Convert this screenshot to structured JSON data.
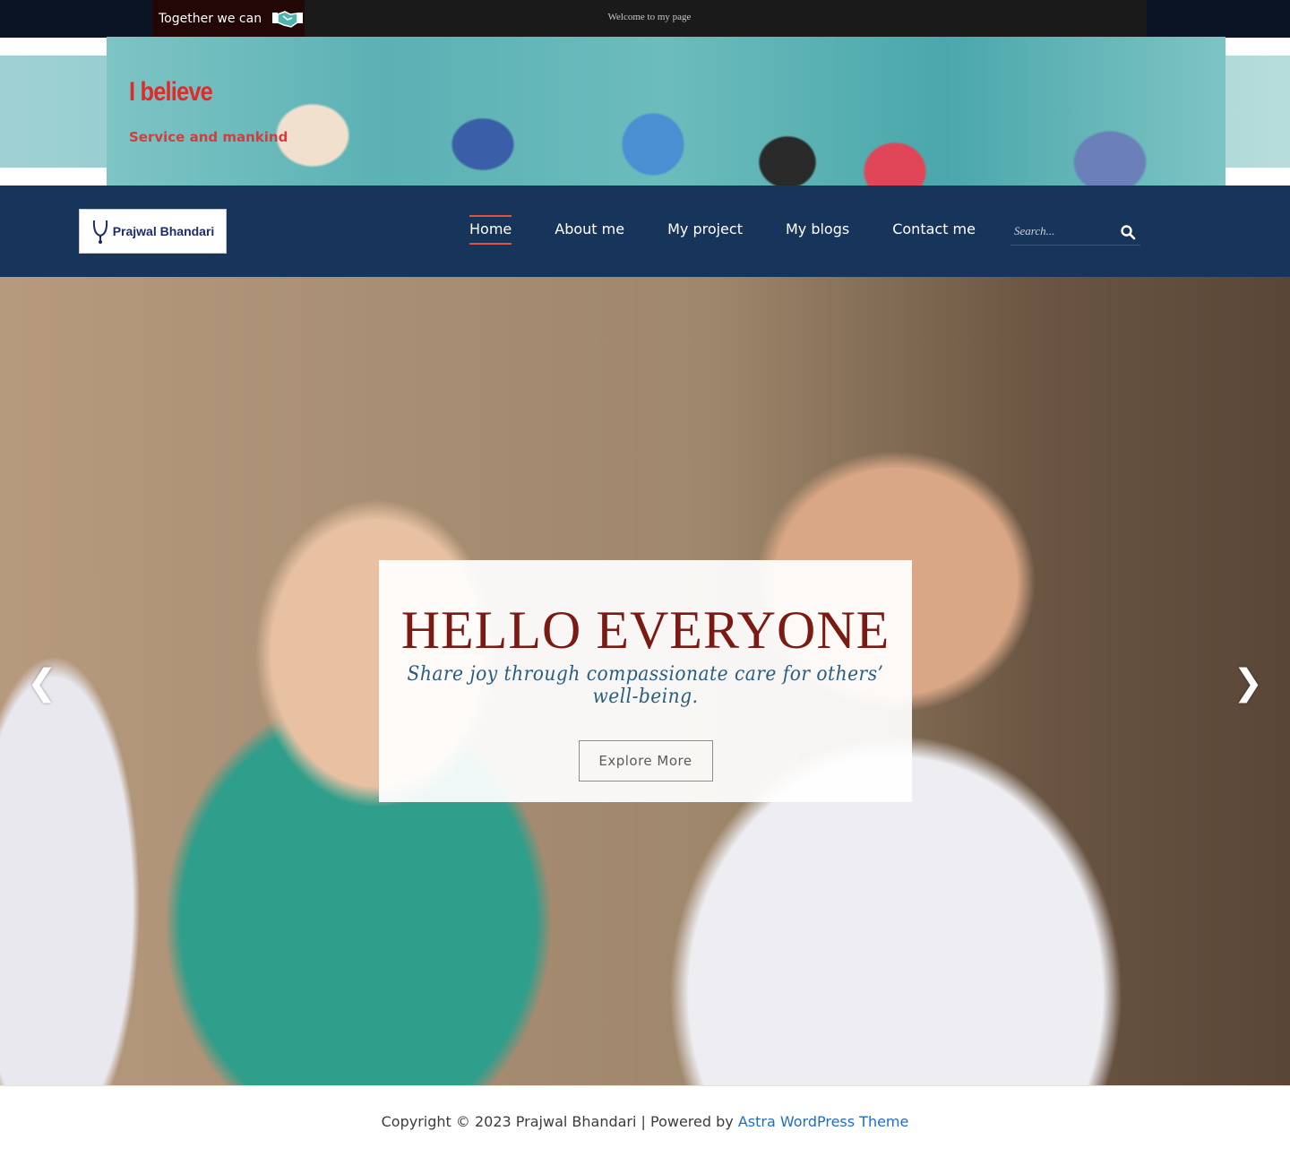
{
  "topbar": {
    "tagline": "Together we can",
    "tagline_icon": "handshake-icon",
    "welcome": "Welcome to my page"
  },
  "header": {
    "site_title": "I believe",
    "site_tagline": "Service and mankind"
  },
  "nav": {
    "logo_text": "Prajwal Bhandari",
    "items": [
      {
        "label": "Home",
        "active": true
      },
      {
        "label": "About me",
        "active": false
      },
      {
        "label": "My project",
        "active": false
      },
      {
        "label": "My blogs",
        "active": false
      },
      {
        "label": "Contact me",
        "active": false
      }
    ],
    "search": {
      "placeholder": "Search...",
      "icon": "search-icon"
    }
  },
  "hero": {
    "title": "HELLO EVERYONE",
    "subtitle": "Share joy through compassionate care for others’ well-being.",
    "button_label": "Explore More",
    "prev_symbol": "❮",
    "next_symbol": "❯"
  },
  "footer": {
    "copyright": "Copyright © 2023 Prajwal Bhandari | Powered by ",
    "link_text": "Astra WordPress Theme"
  },
  "colors": {
    "accent": "#e05343",
    "nav_bg": "#17355a",
    "title_red": "#e02b2b",
    "hero_title": "#7a1a13",
    "link": "#1f6bc7"
  }
}
